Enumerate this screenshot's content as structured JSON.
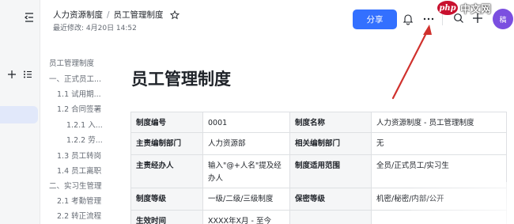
{
  "header": {
    "breadcrumb_parent": "人力资源制度",
    "breadcrumb_separator": "/",
    "breadcrumb_current": "员工管理制度",
    "last_modified": "最近修改: 4月20日 14:52",
    "share_label": "分享",
    "avatar_text": "稿"
  },
  "watermark": {
    "php": "php",
    "cn": "中文网"
  },
  "toc": {
    "items": [
      {
        "label": "员工管理制度"
      },
      {
        "label": "一、正式员工..."
      },
      {
        "label": "1.1 试用期..."
      },
      {
        "label": "1.2 合同签署"
      },
      {
        "label": "1.2.1 入..."
      },
      {
        "label": "1.2.2 劳..."
      },
      {
        "label": "1.3 员工转岗"
      },
      {
        "label": "1.4 员工离职"
      },
      {
        "label": "二、实习生管理"
      },
      {
        "label": "2.1 考勤管理"
      },
      {
        "label": "2.2 转正流程"
      }
    ]
  },
  "document": {
    "title": "员工管理制度",
    "table": {
      "rows": [
        [
          "制度编号",
          "0001",
          "制度名称",
          "人力资源制度 - 员工管理制度"
        ],
        [
          "主责编制部门",
          "人力资源部",
          "相关编制部门",
          "无"
        ],
        [
          "主责经办人",
          "输入\"@+人名\"提及经办人",
          "制度适用范围",
          "全员/正式员工/实习生"
        ],
        [
          "制度等级",
          "一级/二级/三级制度",
          "保密等级",
          "机密/秘密/内部/公开"
        ],
        [
          "生效时间",
          "XXXX年X月 - 至今",
          "",
          ""
        ]
      ]
    }
  },
  "colors": {
    "accent": "#3370ff",
    "arrow": "#d0312d",
    "sidebar_active": "#e1e8fa"
  }
}
